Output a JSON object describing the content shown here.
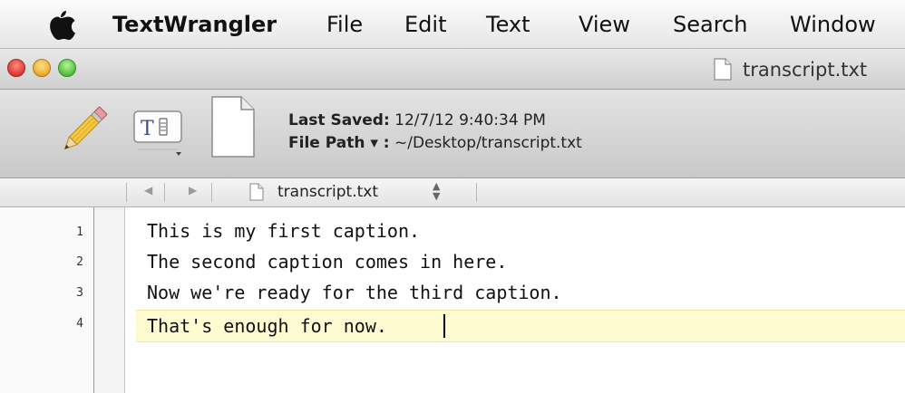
{
  "menubar": {
    "app_name": "TextWrangler",
    "items": [
      "File",
      "Edit",
      "Text",
      "View",
      "Search",
      "Window"
    ]
  },
  "window": {
    "title": "transcript.txt"
  },
  "toolbar": {
    "last_saved_label": "Last Saved:",
    "last_saved_value": "12/7/12 9:40:34 PM",
    "file_path_label": "File Path ▾ :",
    "file_path_value": "~/Desktop/transcript.txt"
  },
  "navbar": {
    "file_name": "transcript.txt"
  },
  "editor": {
    "line_numbers": [
      "1",
      "2",
      "3",
      "4"
    ],
    "lines": [
      "This is my first caption.",
      "The second caption comes in here.",
      "Now we're ready for the third caption.",
      "That's enough for now."
    ],
    "current_line": 4
  }
}
